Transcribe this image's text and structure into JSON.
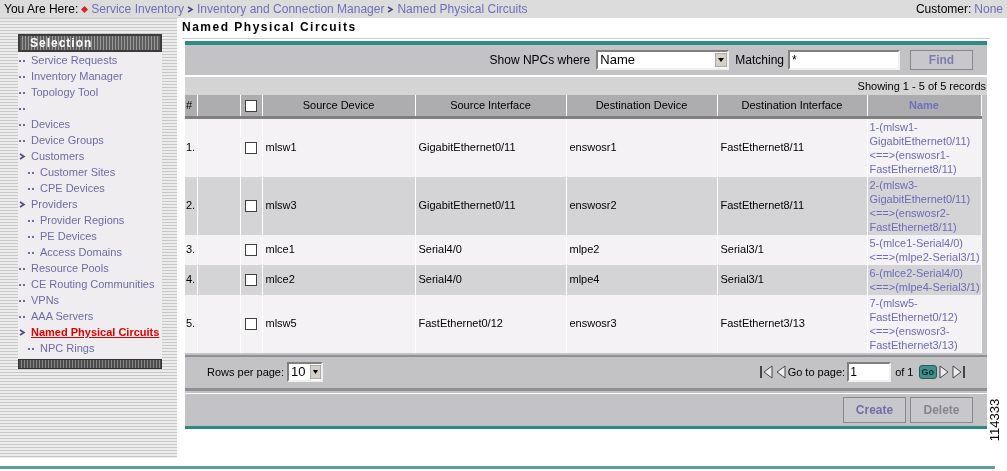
{
  "breadcrumb": {
    "label": "You Are Here:",
    "items": [
      "Service Inventory",
      "Inventory and Connection Manager",
      "Named Physical Circuits"
    ]
  },
  "customer": {
    "label": "Customer:",
    "value": "None"
  },
  "sidebar": {
    "title": "Selection",
    "items": [
      {
        "kind": "link",
        "label": "Service Requests",
        "selected": false
      },
      {
        "kind": "link",
        "label": "Inventory Manager",
        "selected": false
      },
      {
        "kind": "link",
        "label": "Topology Tool",
        "selected": false
      },
      {
        "kind": "spacer"
      },
      {
        "kind": "link",
        "label": "Devices",
        "selected": false
      },
      {
        "kind": "link",
        "label": "Device Groups",
        "selected": false
      },
      {
        "kind": "group",
        "label": "Customers",
        "selected": false,
        "children": [
          {
            "label": "Customer Sites",
            "selected": false
          },
          {
            "label": "CPE Devices",
            "selected": false
          }
        ]
      },
      {
        "kind": "group",
        "label": "Providers",
        "selected": false,
        "children": [
          {
            "label": "Provider Regions",
            "selected": false
          },
          {
            "label": "PE Devices",
            "selected": false
          },
          {
            "label": "Access Domains",
            "selected": false
          }
        ]
      },
      {
        "kind": "link",
        "label": "Resource Pools",
        "selected": false
      },
      {
        "kind": "link",
        "label": "CE Routing Communities",
        "selected": false
      },
      {
        "kind": "link",
        "label": "VPNs",
        "selected": false
      },
      {
        "kind": "link",
        "label": "AAA Servers",
        "selected": false
      },
      {
        "kind": "group",
        "label": "Named Physical Circuits",
        "selected": true,
        "children": [
          {
            "label": "NPC Rings",
            "selected": false
          }
        ]
      }
    ]
  },
  "page_title": "Named Physical Circuits",
  "filter": {
    "label": "Show NPCs where",
    "field": "Name",
    "matching_label": "Matching",
    "matching_value": "*",
    "button": "Find"
  },
  "records": "Showing 1 - 5 of 5 records",
  "table": {
    "columns": [
      "#",
      "Source Device",
      "Source Interface",
      "Destination Device",
      "Destination Interface",
      "Name"
    ],
    "all_checked": false,
    "rows": [
      {
        "cells": [
          "1.",
          "mlsw1",
          "GigabitEthernet0/11",
          "enswosr1",
          "FastEthernet8/11",
          "1-(mlsw1-GigabitEthernet0/11)<==>(enswosr1-FastEthernet8/11)"
        ],
        "checked": false
      },
      {
        "cells": [
          "2.",
          "mlsw3",
          "GigabitEthernet0/11",
          "enswosr2",
          "FastEthernet8/11",
          "2-(mlsw3-GigabitEthernet0/11)<==>(enswosr2-FastEthernet8/11)"
        ],
        "checked": false
      },
      {
        "cells": [
          "3.",
          "mlce1",
          "Serial4/0",
          "mlpe2",
          "Serial3/1",
          "5-(mlce1-Serial4/0)<==>(mlpe2-Serial3/1)"
        ],
        "checked": false
      },
      {
        "cells": [
          "4.",
          "mlce2",
          "Serial4/0",
          "mlpe4",
          "Serial3/1",
          "6-(mlce2-Serial4/0)<==>(mlpe4-Serial3/1)"
        ],
        "checked": false
      },
      {
        "cells": [
          "5.",
          "mlsw5",
          "FastEthernet0/12",
          "enswosr3",
          "FastEthernet3/13",
          "7-(mlsw5-FastEthernet0/12)<==>(enswosr3-FastEthernet3/13)"
        ],
        "checked": false
      }
    ]
  },
  "pager": {
    "rows_label": "Rows per page:",
    "rows_value": "10",
    "goto_label": "Go to page:",
    "page": "1",
    "of": "of 1",
    "go": "Go"
  },
  "buttons": [
    {
      "label": "Create",
      "disabled": false
    },
    {
      "label": "Delete",
      "disabled": true
    }
  ],
  "figure_number": "114333"
}
